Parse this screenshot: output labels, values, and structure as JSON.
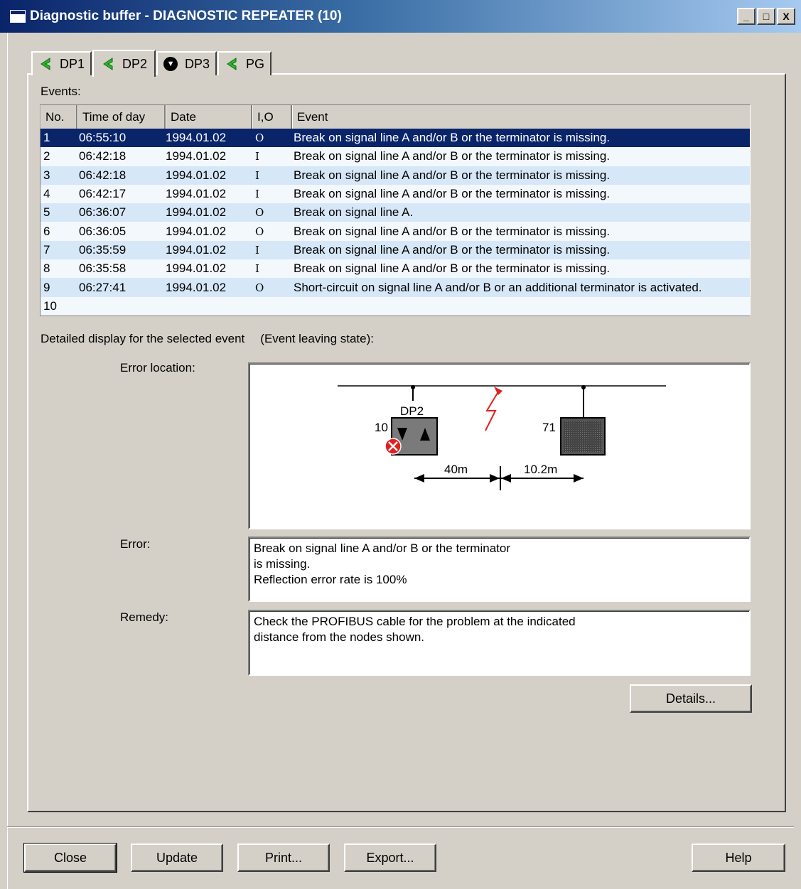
{
  "window": {
    "title": "Diagnostic buffer - DIAGNOSTIC REPEATER (10)",
    "controls": [
      "_",
      "□",
      "X"
    ]
  },
  "tabs": [
    {
      "label": "DP1",
      "icon": "green-arrow-icon"
    },
    {
      "label": "DP2",
      "icon": "green-arrow-icon",
      "active": true
    },
    {
      "label": "DP3",
      "icon": "stop-icon"
    },
    {
      "label": "PG",
      "icon": "green-arrow-icon"
    }
  ],
  "events": {
    "label": "Events:",
    "columns": [
      "No.",
      "Time of day",
      "Date",
      "I,O",
      "Event"
    ],
    "rows": [
      {
        "no": "1",
        "time": "06:55:10",
        "date": "1994.01.02",
        "io": "O",
        "event": "Break on signal line A and/or B or the terminator is missing."
      },
      {
        "no": "2",
        "time": "06:42:18",
        "date": "1994.01.02",
        "io": "I",
        "event": "Break on signal line A and/or B or the terminator is missing."
      },
      {
        "no": "3",
        "time": "06:42:18",
        "date": "1994.01.02",
        "io": "I",
        "event": "Break on signal line A and/or B or the terminator is missing."
      },
      {
        "no": "4",
        "time": "06:42:17",
        "date": "1994.01.02",
        "io": "I",
        "event": "Break on signal line A and/or B or the terminator is missing."
      },
      {
        "no": "5",
        "time": "06:36:07",
        "date": "1994.01.02",
        "io": "O",
        "event": "Break on signal line A."
      },
      {
        "no": "6",
        "time": "06:36:05",
        "date": "1994.01.02",
        "io": "O",
        "event": "Break on signal line A and/or B or the terminator is missing."
      },
      {
        "no": "7",
        "time": "06:35:59",
        "date": "1994.01.02",
        "io": "I",
        "event": "Break on signal line A and/or B or the terminator is missing."
      },
      {
        "no": "8",
        "time": "06:35:58",
        "date": "1994.01.02",
        "io": "I",
        "event": "Break on signal line A and/or B or the terminator is missing."
      },
      {
        "no": "9",
        "time": "06:27:41",
        "date": "1994.01.02",
        "io": "O",
        "event": "Short-circuit on signal line A and/or B or an additional terminator is activated."
      },
      {
        "no": "10",
        "time": "",
        "date": "",
        "io": "",
        "event": ""
      }
    ],
    "selected_index": 0
  },
  "detail": {
    "label": "Detailed display for the selected event",
    "state": "(Event leaving state):",
    "error_location_label": "Error location:",
    "diagram": {
      "segment_label": "DP2",
      "left_node": "10",
      "right_node": "71",
      "dist_left": "40m",
      "dist_right": "10.2m"
    },
    "error_label": "Error:",
    "error_lines": [
      "Break on signal line A and/or B or the terminator",
      "is missing.",
      "Reflection error rate is 100%"
    ],
    "remedy_label": "Remedy:",
    "remedy_lines": [
      "Check the PROFIBUS cable for the problem at the indicated",
      "distance from the nodes shown."
    ],
    "details_button": "Details..."
  },
  "buttons": {
    "close": "Close",
    "update": "Update",
    "print": "Print...",
    "export": "Export...",
    "help": "Help"
  },
  "colors": {
    "selection": "#0a246a",
    "row_odd": "#d6e7f7",
    "row_even": "#f3f8fd",
    "lightning": "#e02020"
  }
}
